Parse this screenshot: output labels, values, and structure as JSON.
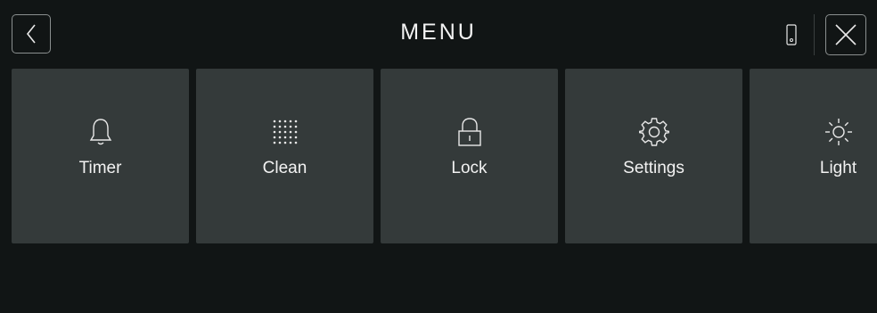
{
  "header": {
    "title": "MENU",
    "back_icon": "chevron-left-icon",
    "device_icon": "phone-icon",
    "close_icon": "close-icon"
  },
  "tiles": [
    {
      "label": "Timer",
      "icon": "bell-icon"
    },
    {
      "label": "Clean",
      "icon": "dot-grid-icon"
    },
    {
      "label": "Lock",
      "icon": "lock-icon"
    },
    {
      "label": "Settings",
      "icon": "gear-icon"
    },
    {
      "label": "Light",
      "icon": "sun-icon"
    }
  ],
  "colors": {
    "background": "#111515",
    "tile": "#343a3a",
    "text": "#f2f2f2",
    "border": "#8a8f8f"
  }
}
